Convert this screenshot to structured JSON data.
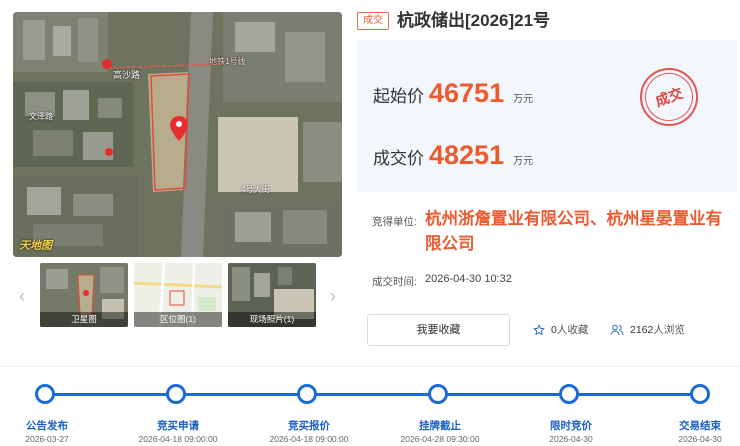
{
  "map": {
    "watermark": "天地图",
    "labels": {
      "station": "高沙路",
      "metro": "地铁1号线",
      "left_road": "文泽路",
      "street": "4号大街"
    }
  },
  "thumbnails": [
    {
      "caption": "卫星图"
    },
    {
      "caption": "区位图(1)"
    },
    {
      "caption": "现场照片(1)"
    }
  ],
  "arrows": {
    "prev": "‹",
    "next": "›"
  },
  "status_badge": "成交",
  "title": "杭政储出[2026]21号",
  "prices": {
    "start_label": "起始价",
    "start_value": "46751",
    "start_unit": "万元",
    "deal_label": "成交价",
    "deal_value": "48251",
    "deal_unit": "万元"
  },
  "stamp_text": "成交",
  "winner": {
    "label": "竞得单位:",
    "name": "杭州浙詹置业有限公司、杭州星晏置业有限公司"
  },
  "deal_time": {
    "label": "成交时间:",
    "value": "2026-04-30 10:32"
  },
  "actions": {
    "favorite_label": "我要收藏",
    "favorites_count": "0",
    "favorites_suffix": "人收藏",
    "views_count": "2162",
    "views_suffix": "人浏览"
  },
  "timeline": [
    {
      "label": "公告发布",
      "date": "2026-03-27"
    },
    {
      "label": "竞买申请",
      "date": "2026-04-18 09:00:00"
    },
    {
      "label": "竞买报价",
      "date": "2026-04-18 09:00:00"
    },
    {
      "label": "挂牌截止",
      "date": "2026-04-28 09:30:00"
    },
    {
      "label": "限时竞价",
      "date": "2026-04-30"
    },
    {
      "label": "交易结束",
      "date": "2026-04-30"
    }
  ],
  "colors": {
    "accent_orange": "#ee5a2f",
    "timeline_blue": "#1a6ad8",
    "stamp_red": "#e25553",
    "price_panel_bg": "#f3f7fb"
  }
}
